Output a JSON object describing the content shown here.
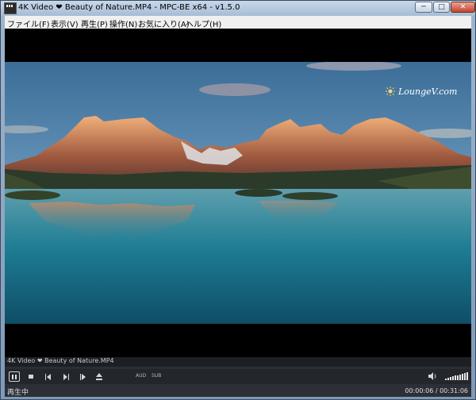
{
  "window": {
    "title": "4K Video ❤ Beauty of Nature.MP4 - MPC-BE x64 - v1.5.0",
    "min_glyph": "─",
    "max_glyph": "□",
    "close_glyph": "✕"
  },
  "menu": [
    {
      "label": "ファイル(F)"
    },
    {
      "label": "表示(V)"
    },
    {
      "label": "再生(P)"
    },
    {
      "label": "操作(N)"
    },
    {
      "label": "お気に入り(A)"
    },
    {
      "label": "ヘルプ(H)"
    }
  ],
  "video": {
    "watermark": "LoungeV.com",
    "watermark_icon": "sun-icon"
  },
  "filebar": {
    "file_name": "4K Video ❤ Beauty of Nature.MP4"
  },
  "controls": {
    "audio_label": "AUD",
    "subtitle_label": "SUB",
    "volume_icon": "speaker-icon",
    "volume_level": 1.0
  },
  "status": {
    "state": "再生中",
    "time": "00:00:06 / 00:31:06"
  }
}
